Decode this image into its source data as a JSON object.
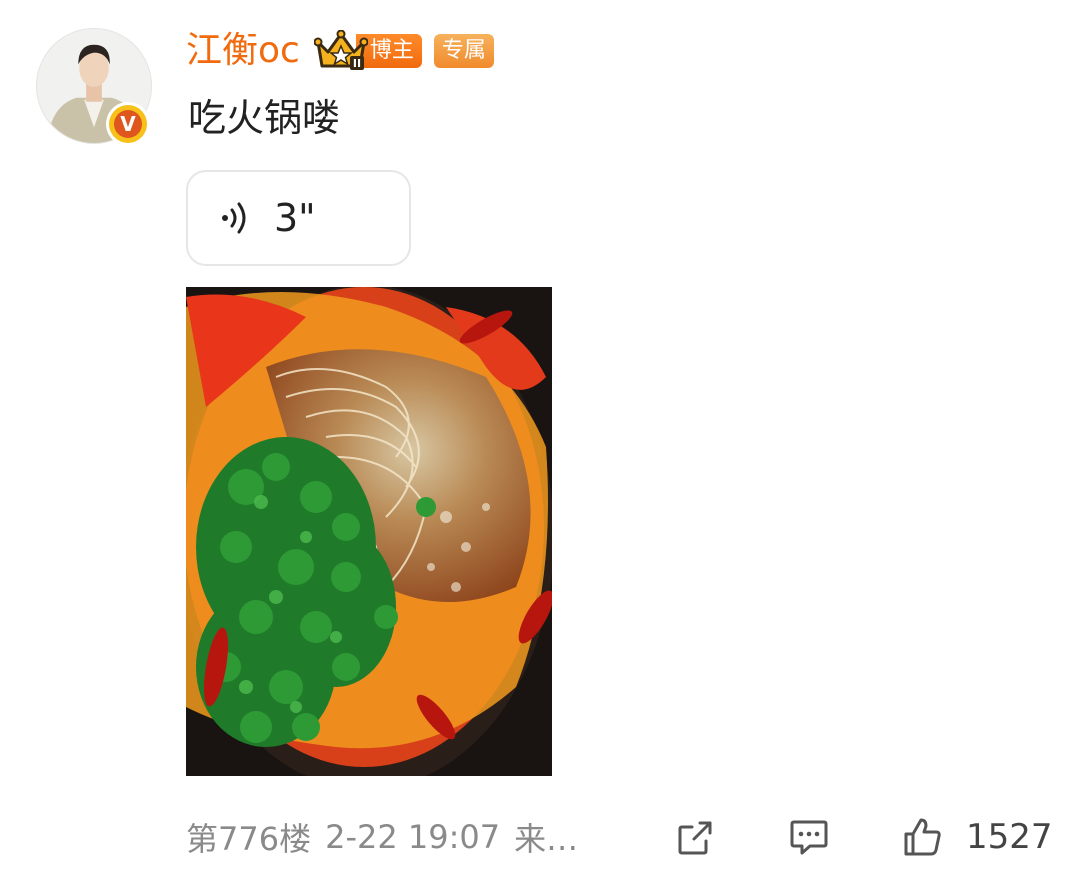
{
  "comment": {
    "username": "江衡oc",
    "badges": {
      "level": "II",
      "bozhu": "博主",
      "exclusive": "专属"
    },
    "verified_icon": "v-verified-icon",
    "text": "吃火锅喽",
    "voice": {
      "duration": "3\"",
      "icon": "sound-wave-icon"
    },
    "photo": {
      "subject": "hotpot",
      "icon": "food-photo"
    },
    "footer": {
      "floor": "第776楼",
      "time": "2-22 19:07",
      "source": "来…",
      "like_count": "1527"
    },
    "actions": {
      "share_icon": "share-icon",
      "reply_icon": "comment-icon",
      "like_icon": "thumbs-up-icon"
    },
    "colors": {
      "username": "#f06a0e",
      "badge_orange": "#f06a0e",
      "meta_gray": "#8a8a8a"
    }
  }
}
